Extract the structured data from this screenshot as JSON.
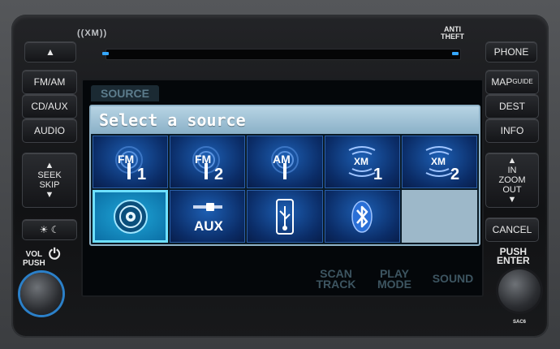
{
  "brand": {
    "xm_logo": "((XM))",
    "anti_theft": [
      "ANTI",
      "THEFT"
    ],
    "bottom_mark": "SAC6"
  },
  "left_buttons": {
    "eject": "▲",
    "fm_am": "FM/AM",
    "cd_aux": "CD/AUX",
    "audio": "AUDIO",
    "seek_skip": [
      "SEEK",
      "SKIP"
    ],
    "brightness": "☀ ☾",
    "vol_push": [
      "VOL",
      "PUSH"
    ],
    "power_icon": "⏻"
  },
  "right_buttons": {
    "phone": "PHONE",
    "map_guide_map": "MAP",
    "map_guide_guide": "GUIDE",
    "dest": "DEST",
    "info": "INFO",
    "in_zoom_out": [
      "IN",
      "ZOOM",
      "OUT"
    ],
    "cancel": "CANCEL",
    "push_enter": [
      "PUSH",
      "ENTER"
    ]
  },
  "screen": {
    "tab_label": "SOURCE",
    "dialog_title": "Select a source",
    "sources": [
      {
        "name": "FM1",
        "icon": "fm-antenna-icon",
        "top": "FM",
        "num": "1"
      },
      {
        "name": "FM2",
        "icon": "fm-antenna-icon",
        "top": "FM",
        "num": "2"
      },
      {
        "name": "AM",
        "icon": "am-antenna-icon",
        "top": "AM",
        "num": ""
      },
      {
        "name": "XM1",
        "icon": "xm-icon",
        "top": "XM",
        "num": "1"
      },
      {
        "name": "XM2",
        "icon": "xm-icon",
        "top": "XM",
        "num": "2"
      },
      {
        "name": "CD",
        "icon": "cd-disc-icon",
        "top": "",
        "num": ""
      },
      {
        "name": "AUX",
        "icon": "aux-plug-icon",
        "top": "AUX",
        "num": ""
      },
      {
        "name": "USB",
        "icon": "usb-icon",
        "top": "",
        "num": ""
      },
      {
        "name": "Bluetooth",
        "icon": "bluetooth-icon",
        "top": "",
        "num": ""
      }
    ],
    "selected_source": "CD",
    "bottom_labels": {
      "scan_track": [
        "SCAN",
        "TRACK"
      ],
      "play_mode": [
        "PLAY",
        "MODE"
      ],
      "sound": "SOUND"
    }
  },
  "colors": {
    "accent": "#6ee0ff",
    "tile_blue": "#1d5fb3",
    "title_bar": "#b7d4e4"
  }
}
